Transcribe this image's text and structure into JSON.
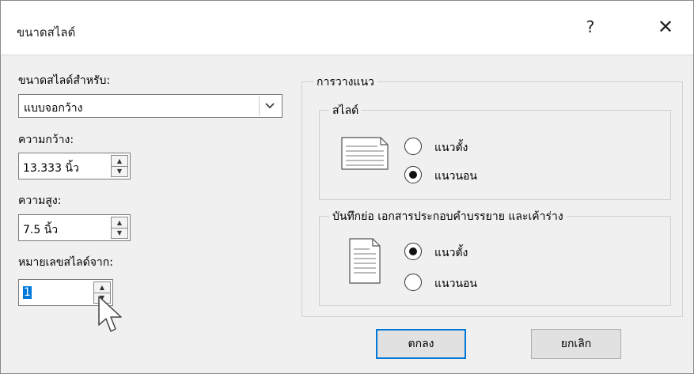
{
  "dialog": {
    "title": "ขนาดสไลด์",
    "help_label": "?",
    "close_label": "✕"
  },
  "left": {
    "slide_size_label": "ขนาดสไลด์สำหรับ:",
    "slide_size_value": "แบบจอกว้าง",
    "width_label": "ความกว้าง:",
    "width_value": "13.333 นิ้ว",
    "height_label": "ความสูง:",
    "height_value": "7.5 นิ้ว",
    "number_from_label": "หมายเลขสไลด์จาก:",
    "number_from_value": "1"
  },
  "orientation": {
    "title": "การวางแนว",
    "slides": {
      "title": "สไลด์",
      "options": [
        {
          "label": "แนวตั้ง",
          "checked": false
        },
        {
          "label": "แนวนอน",
          "checked": true
        }
      ]
    },
    "notes": {
      "title": "บันทึกย่อ เอกสารประกอบคำบรรยาย และเค้าร่าง",
      "options": [
        {
          "label": "แนวตั้ง",
          "checked": true
        },
        {
          "label": "แนวนอน",
          "checked": false
        }
      ]
    }
  },
  "buttons": {
    "ok": "ตกลง",
    "cancel": "ยกเลิก"
  },
  "icons": {
    "dropdown": "chevron-down-icon",
    "landscape_page": "landscape-page-icon",
    "portrait_page": "portrait-page-icon",
    "cursor": "mouse-pointer-icon"
  }
}
